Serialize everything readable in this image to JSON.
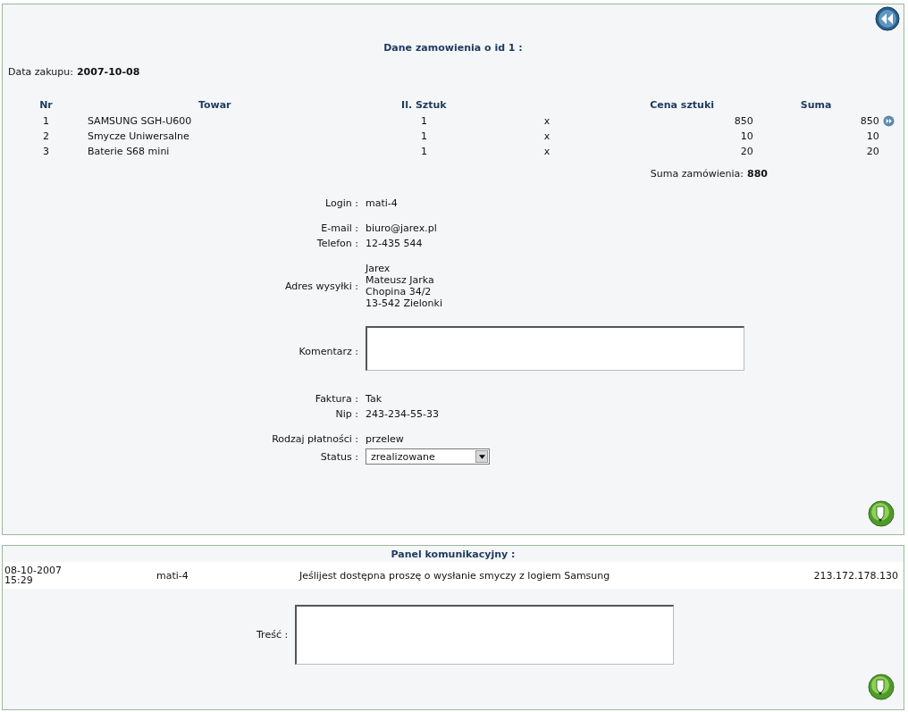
{
  "order_panel": {
    "title": "Dane zamowienia o id 1 :",
    "purchase_date": {
      "label": "Data zakupu:",
      "value": "2007-10-08"
    },
    "table": {
      "columns": [
        "Nr",
        "Towar",
        "Il. Sztuk",
        "Cena sztuki",
        "Suma"
      ],
      "rows": [
        {
          "nr": "1",
          "item": "SAMSUNG SGH-U600",
          "qty": "1",
          "times": "x",
          "price": "850",
          "total": "850",
          "detail_link": true
        },
        {
          "nr": "2",
          "item": "Smycze Uniwersalne",
          "qty": "1",
          "times": "x",
          "price": "10",
          "total": "10",
          "detail_link": false
        },
        {
          "nr": "3",
          "item": "Baterie S68 mini",
          "qty": "1",
          "times": "x",
          "price": "20",
          "total": "20",
          "detail_link": false
        }
      ]
    },
    "order_total": {
      "label": "Suma zamówienia:",
      "value": "880"
    },
    "details": [
      [
        {
          "kind": "text",
          "label": "Login :",
          "value": "mati-4"
        }
      ],
      [
        {
          "kind": "text",
          "label": "E-mail :",
          "value": "biuro@jarex.pl"
        },
        {
          "kind": "text",
          "label": "Telefon :",
          "value": "12-435 544"
        }
      ],
      [
        {
          "kind": "lines",
          "label": "Adres wysyłki :",
          "lines": [
            "Jarex",
            "Mateusz Jarka",
            "Chopina 34/2",
            "13-542 Zielonki"
          ]
        }
      ],
      [
        {
          "kind": "textarea",
          "label": "Komentarz :"
        }
      ],
      [
        {
          "kind": "text",
          "label": "Faktura :",
          "value": "Tak"
        },
        {
          "kind": "text",
          "label": "Nip :",
          "value": "243-234-55-33"
        }
      ],
      [
        {
          "kind": "text",
          "label": "Rodzaj płatności :",
          "value": "przelew"
        },
        {
          "kind": "select",
          "label": "Status :",
          "value": "zrealizowane"
        }
      ]
    ]
  },
  "message_panel": {
    "title": "Panel komunikacyjny :",
    "messages": [
      {
        "date": "08-10-2007",
        "time": "15:29",
        "user": "mati-4",
        "text": "Jeślijest dostępna proszę o wysłanie smyczy z logiem Samsung",
        "ip": "213.172.178.130"
      }
    ],
    "reply_label": "Treść :"
  }
}
